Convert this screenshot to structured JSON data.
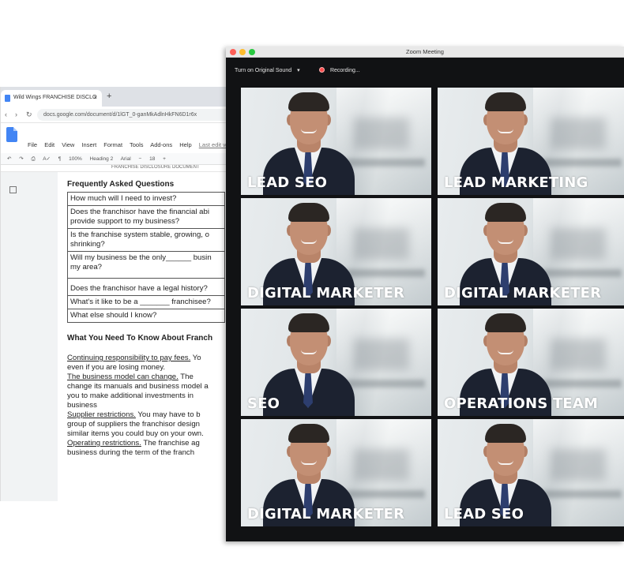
{
  "gdocs": {
    "tab_title": "Wild Wings FRANCHISE DISCLO",
    "tab_close": "×",
    "new_tab": "+",
    "url": "docs.google.com/document/d/1lGT_0-ganMkAdlnHkFN6D1r6x",
    "menu": [
      "File",
      "Edit",
      "View",
      "Insert",
      "Format",
      "Tools",
      "Add-ons",
      "Help"
    ],
    "last_edit": "Last edit wa",
    "toolbar": {
      "zoom": "100%",
      "style": "Heading 2",
      "font": "Arial",
      "size": "18"
    },
    "ruler_text": "FRANCHISE DISCLOSURE DOCUMENT",
    "faq_heading": "Frequently Asked Questions",
    "faq_rows": [
      [
        "How much will I need to invest?"
      ],
      [
        "Does the franchisor have the financial abi",
        "provide support to my business?"
      ],
      [
        "Is the franchise system stable, growing, o",
        "shrinking?"
      ],
      [
        "Will my business be the only______ busin",
        "my area?"
      ],
      [
        "Does the franchisor have a legal history?"
      ],
      [
        "What's it like to be a _______ franchisee?"
      ],
      [
        "What else should I know?"
      ]
    ],
    "section_heading": "What You Need To Know About Franch",
    "paragraph_lines": [
      {
        "u": "Continuing responsibility to pay fees.",
        "t": " Yo"
      },
      {
        "u": "",
        "t": "even if you are losing money."
      },
      {
        "u": "The business model can change.",
        "t": " The"
      },
      {
        "u": "",
        "t": "change its manuals and business model a"
      },
      {
        "u": "",
        "t": "you to make additional investments in"
      },
      {
        "u": "",
        "t": "business"
      },
      {
        "u": "Supplier restrictions.",
        "t": " You may have to b"
      },
      {
        "u": "",
        "t": "group of suppliers the franchisor design"
      },
      {
        "u": "",
        "t": "similar items you could buy on your own."
      },
      {
        "u": "Operating restrictions.",
        "t": " The franchise ag"
      },
      {
        "u": "",
        "t": "business during the term of the franch"
      }
    ]
  },
  "zoom": {
    "window_title": "Zoom Meeting",
    "original_sound": "Turn on Original Sound",
    "recording": "Recording...",
    "participants": [
      {
        "label": "LEAD SEO"
      },
      {
        "label": "LEAD MARKETING"
      },
      {
        "label": "DIGITAL MARKETER"
      },
      {
        "label": "DIGITAL MARKETER"
      },
      {
        "label": "SEO"
      },
      {
        "label": "OPERATIONS TEAM"
      },
      {
        "label": "DIGITAL MARKETER"
      },
      {
        "label": "LEAD SEO"
      }
    ]
  },
  "colors": {
    "zoom_bg": "#111214",
    "traffic_red": "#fe5f57",
    "traffic_yellow": "#febc2e",
    "traffic_green": "#28c840",
    "recording_dot": "#ff4d4d",
    "docs_blue": "#4285f4"
  }
}
